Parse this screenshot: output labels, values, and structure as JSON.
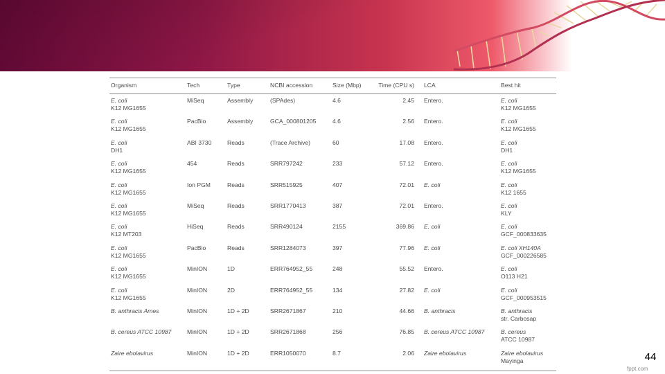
{
  "banner": {
    "colors": {
      "dark": "#6b0a3a",
      "mid": "#c8344f",
      "light": "#ee5a6a"
    }
  },
  "table": {
    "headers": [
      "Organism",
      "Tech",
      "Type",
      "NCBI accession",
      "Size (Mbp)",
      "Time (CPU s)",
      "LCA",
      "Best hit"
    ],
    "rows": [
      {
        "organism": [
          "E. coli",
          "K12 MG1655"
        ],
        "tech": "MiSeq",
        "type": "Assembly",
        "accession": "(SPAdes)",
        "size": "4.6",
        "time": "2.45",
        "lca": "Entero.",
        "lca_italic": false,
        "besthit": [
          "E. coli",
          "K12 MG1655"
        ]
      },
      {
        "organism": [
          "E. coli",
          "K12 MG1655"
        ],
        "tech": "PacBio",
        "type": "Assembly",
        "accession": "GCA_000801205",
        "size": "4.6",
        "time": "2.56",
        "lca": "Entero.",
        "lca_italic": false,
        "besthit": [
          "E. coli",
          "K12 MG1655"
        ]
      },
      {
        "organism": [
          "E. coli",
          "DH1"
        ],
        "tech": "ABI 3730",
        "type": "Reads",
        "accession": "(Trace Archive)",
        "size": "60",
        "time": "17.08",
        "lca": "Entero.",
        "lca_italic": false,
        "besthit": [
          "E. coli",
          "DH1"
        ]
      },
      {
        "organism": [
          "E. coli",
          "K12 MG1655"
        ],
        "tech": "454",
        "type": "Reads",
        "accession": "SRR797242",
        "size": "233",
        "time": "57.12",
        "lca": "Entero.",
        "lca_italic": false,
        "besthit": [
          "E. coli",
          "K12 MG1655"
        ]
      },
      {
        "organism": [
          "E. coli",
          "K12 MG1655"
        ],
        "tech": "Ion PGM",
        "type": "Reads",
        "accession": "SRR515925",
        "size": "407",
        "time": "72.01",
        "lca": "E. coli",
        "lca_italic": true,
        "besthit": [
          "E. coli",
          "K12 1655"
        ]
      },
      {
        "organism": [
          "E. coli",
          "K12 MG1655"
        ],
        "tech": "MiSeq",
        "type": "Reads",
        "accession": "SRR1770413",
        "size": "387",
        "time": "72.01",
        "lca": "Entero.",
        "lca_italic": false,
        "besthit": [
          "E. coli",
          "KLY"
        ]
      },
      {
        "organism": [
          "E. coli",
          "K12 MT203"
        ],
        "tech": "HiSeq",
        "type": "Reads",
        "accession": "SRR490124",
        "size": "2155",
        "time": "369.86",
        "lca": "E. coli",
        "lca_italic": true,
        "besthit": [
          "E. coli",
          "GCF_000833635"
        ]
      },
      {
        "organism": [
          "E. coli",
          "K12 MG1655"
        ],
        "tech": "PacBio",
        "type": "Reads",
        "accession": "SRR1284073",
        "size": "397",
        "time": "77.96",
        "lca": "E. coli",
        "lca_italic": true,
        "besthit": [
          "E. coli XH140A",
          "GCF_000226585"
        ]
      },
      {
        "organism": [
          "E. coli",
          "K12 MG1655"
        ],
        "tech": "MinION",
        "type": "1D",
        "accession": "ERR764952_55",
        "size": "248",
        "time": "55.52",
        "lca": "Entero.",
        "lca_italic": false,
        "besthit": [
          "E. coli",
          "O113 H21"
        ]
      },
      {
        "organism": [
          "E. coli",
          "K12 MG1655"
        ],
        "tech": "MinION",
        "type": "2D",
        "accession": "ERR764952_55",
        "size": "134",
        "time": "27.82",
        "lca": "E. coli",
        "lca_italic": true,
        "besthit": [
          "E. coli",
          "GCF_000953515"
        ]
      },
      {
        "organism": [
          "B. anthracis Ames",
          ""
        ],
        "tech": "MinION",
        "type": "1D + 2D",
        "accession": "SRR2671867",
        "size": "210",
        "time": "44.66",
        "lca": "B. anthracis",
        "lca_italic": true,
        "besthit": [
          "B. anthracis",
          "str. Carbosap"
        ]
      },
      {
        "organism": [
          "B. cereus ATCC 10987",
          ""
        ],
        "tech": "MinION",
        "type": "1D + 2D",
        "accession": "SRR2671868",
        "size": "256",
        "time": "76.85",
        "lca": "B. cereus ATCC 10987",
        "lca_italic": true,
        "besthit": [
          "B. cereus",
          "ATCC 10987"
        ]
      },
      {
        "organism": [
          "Zaire ebolavirus",
          ""
        ],
        "tech": "MinION",
        "type": "1D + 2D",
        "accession": "ERR1050070",
        "size": "8.7",
        "time": "2.06",
        "lca": "Zaire ebolavirus",
        "lca_italic": true,
        "besthit": [
          "Zaire ebolavirus",
          "Mayinga"
        ]
      }
    ]
  },
  "page_number": "44",
  "footer_brand": "fppt.com"
}
